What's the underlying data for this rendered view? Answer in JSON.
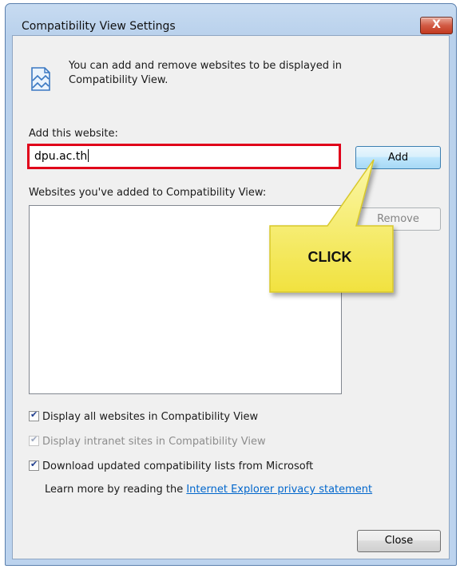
{
  "window": {
    "title": "Compatibility View Settings",
    "close_glyph": "X"
  },
  "info": {
    "icon": "compatibility-view-icon",
    "text": "You can add and remove websites to be displayed in Compatibility View."
  },
  "add_section": {
    "label": "Add this website:",
    "value": "dpu.ac.th",
    "add_button": "Add"
  },
  "list_section": {
    "label": "Websites you've added to Compatibility View:",
    "items": [],
    "remove_button": "Remove"
  },
  "options": [
    {
      "label": "Display all websites in Compatibility View",
      "checked": true,
      "enabled": true
    },
    {
      "label": "Display intranet sites in Compatibility View",
      "checked": true,
      "enabled": false
    },
    {
      "label": "Download updated compatibility lists from Microsoft",
      "checked": true,
      "enabled": true
    }
  ],
  "privacy": {
    "prefix": "Learn more by reading the",
    "link_text": "Internet Explorer privacy statement"
  },
  "close_button": "Close",
  "annotation": {
    "callout_text": "CLICK",
    "highlight_color": "#e0001a",
    "callout_color": "#f7f06a"
  }
}
